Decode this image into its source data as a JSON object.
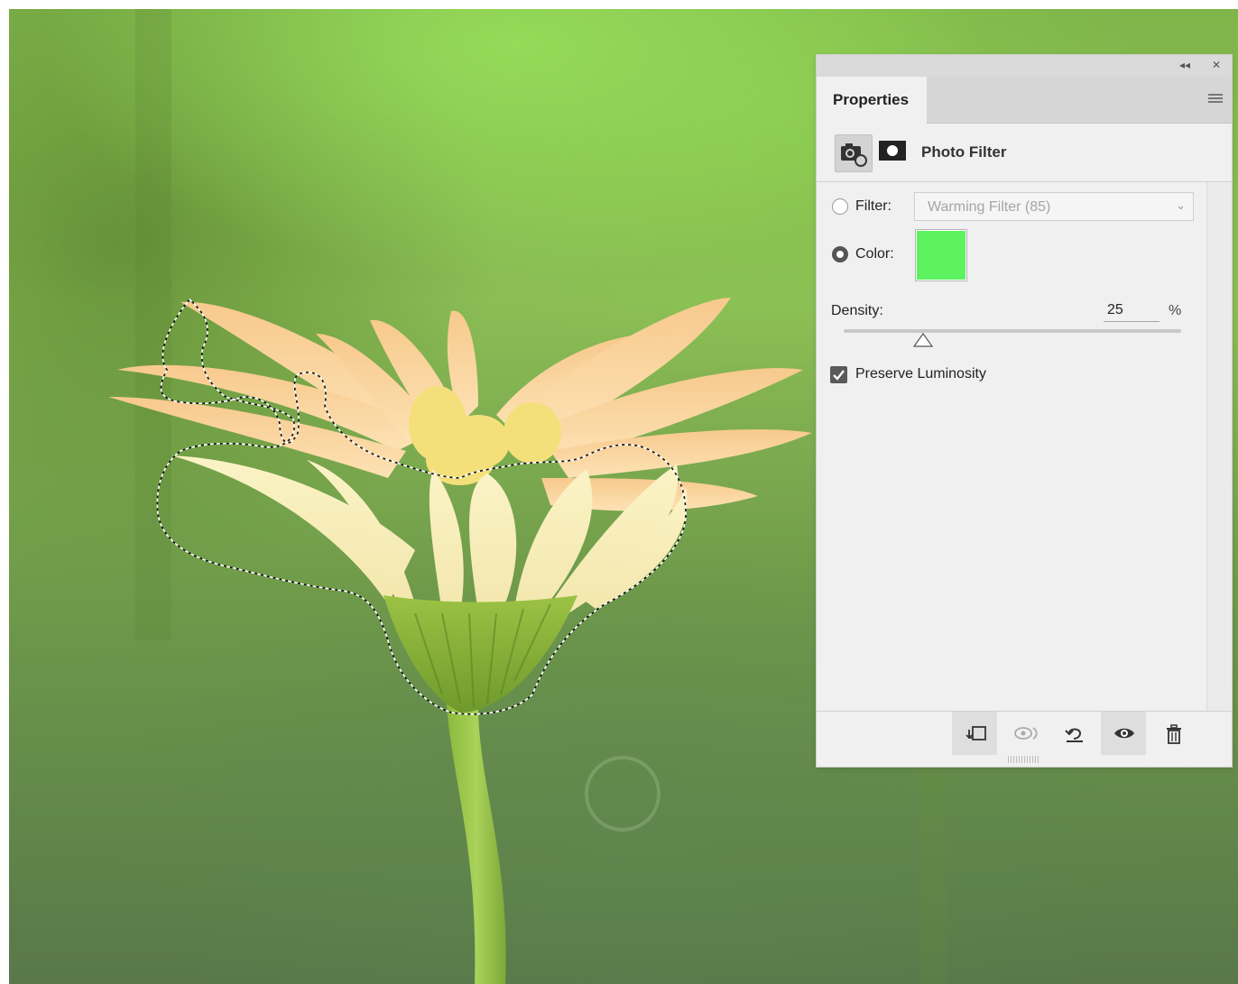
{
  "panel": {
    "collapse_icon": "collapse-panel-icon",
    "close_icon": "close-panel-icon",
    "tab_label": "Properties",
    "menu_icon": "panel-menu-icon"
  },
  "adjustment": {
    "title": "Photo Filter",
    "icons": [
      "photo-filter-adjustment-icon",
      "layer-mask-icon"
    ]
  },
  "filter": {
    "label": "Filter:",
    "selected": "Warming Filter (85)",
    "enabled": false
  },
  "color": {
    "label": "Color:",
    "value": "#5ef260",
    "selected": true
  },
  "density": {
    "label": "Density:",
    "value": "25",
    "unit": "%"
  },
  "preserve_luminosity": {
    "label": "Preserve Luminosity",
    "checked": true
  },
  "footer_icons": [
    "clip-to-layer-icon",
    "view-previous-state-icon",
    "reset-adjustment-icon",
    "toggle-visibility-icon",
    "delete-adjustment-icon"
  ],
  "canvas": {
    "content": "flower-photo",
    "selection": "marching-ants-selection"
  }
}
